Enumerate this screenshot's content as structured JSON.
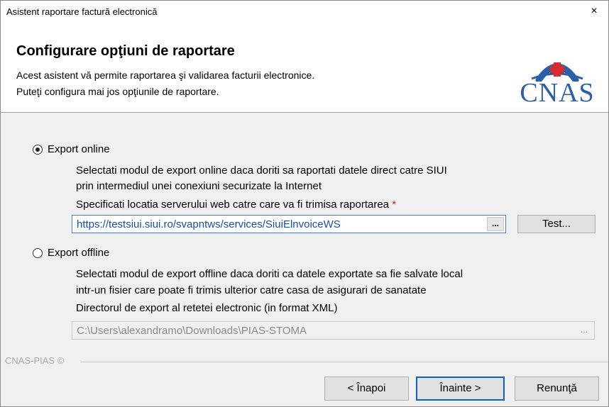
{
  "window": {
    "title": "Asistent raportare factură electronică",
    "close_glyph": "×"
  },
  "header": {
    "heading": "Configurare opţiuni de raportare",
    "description_line1": "Acest asistent vă permite raportarea şi validarea facturii electronice.",
    "description_line2": "Puteţi configura mai jos opţiunile de raportare.",
    "logo_text": "CNAS",
    "logo_icon": "cnas-logo-icon",
    "accent_color": "#2b5fa8",
    "logo_red": "#d82b2b"
  },
  "export_online": {
    "label": "Export online",
    "selected": true,
    "description_line1": "Selectati modul de export online daca doriti sa raportati datele direct catre SIUI",
    "description_line2": "prin intermediul unei conexiuni securizate la Internet",
    "server_label": "Specificati locatia serverului web catre care va fi trimisa raportarea",
    "required_marker": "*",
    "server_url": "https://testsiui.siui.ro/svapntws/services/SiuiElnvoiceWS",
    "browse_label": "...",
    "test_button": "Test..."
  },
  "export_offline": {
    "label": "Export offline",
    "selected": false,
    "description_line1": "Selectati modul de export offline daca doriti ca datele exportate sa fie salvate local",
    "description_line2": "intr-un fisier care poate fi trimis ulterior catre casa de asigurari de sanatate",
    "directory_label": "Directorul de export al retetei electronic (in format XML)",
    "directory_value": "C:\\Users\\alexandramo\\Downloads\\PIAS-STOMA",
    "browse_label": "..."
  },
  "footer": {
    "brand": "CNAS-PIAS ©",
    "back_button": "< Înapoi",
    "next_button": "Înainte >",
    "cancel_button": "Renunţă"
  }
}
